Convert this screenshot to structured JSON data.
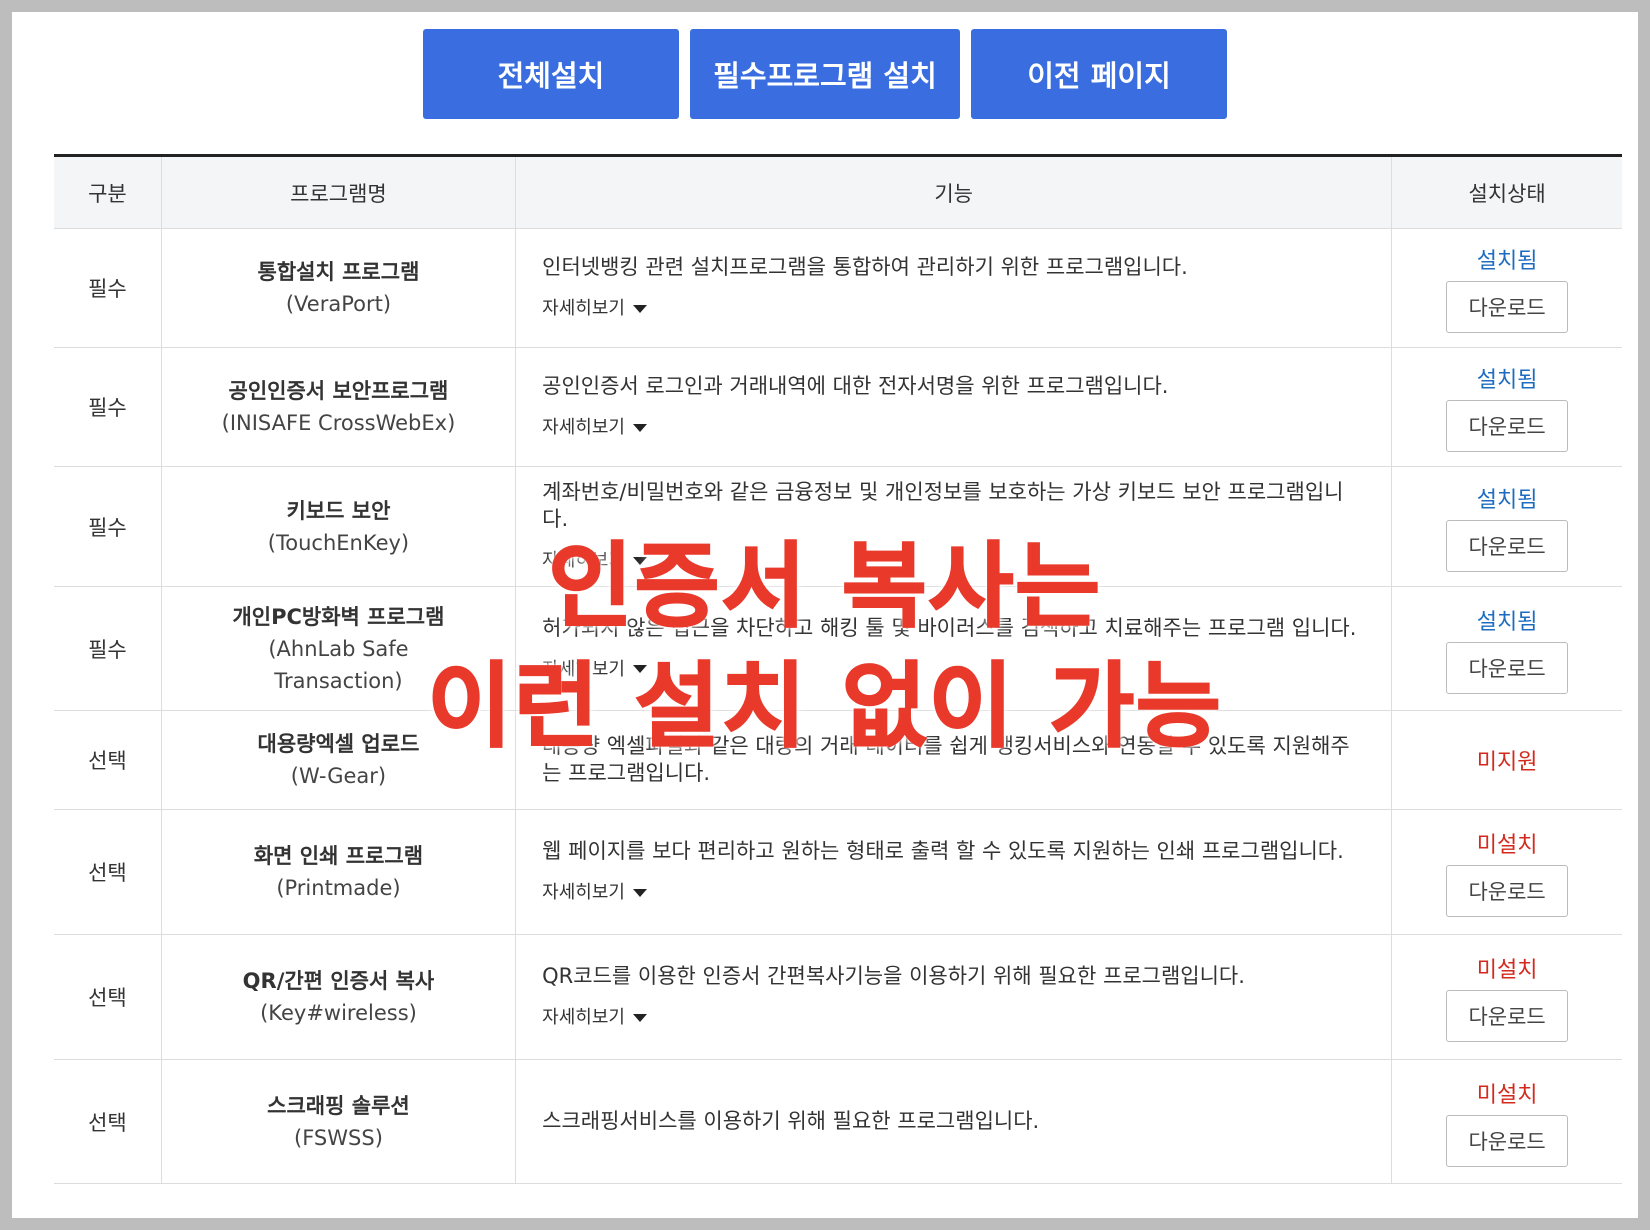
{
  "buttons": {
    "install_all": "전체설치",
    "install_required": "필수프로그램 설치",
    "previous_page": "이전 페이지"
  },
  "table": {
    "headers": {
      "category": "구분",
      "program": "프로그램명",
      "function": "기능",
      "status": "설치상태"
    },
    "rows": [
      {
        "category": "필수",
        "name": "통합설치 프로그램",
        "sub": "(VeraPort)",
        "desc": "인터넷뱅킹 관련 설치프로그램을 통합하여 관리하기 위한 프로그램입니다.",
        "more": "자세히보기",
        "status": "설치됨",
        "download": "다운로드"
      },
      {
        "category": "필수",
        "name": "공인인증서 보안프로그램",
        "sub": "(INISAFE CrossWebEx)",
        "desc": "공인인증서 로그인과 거래내역에 대한 전자서명을 위한 프로그램입니다.",
        "more": "자세히보기",
        "status": "설치됨",
        "download": "다운로드"
      },
      {
        "category": "필수",
        "name": "키보드 보안",
        "sub": "(TouchEnKey)",
        "desc": "계좌번호/비밀번호와 같은 금융정보 및 개인정보를 보호하는 가상 키보드 보안 프로그램입니다.",
        "more": "자세히보기",
        "status": "설치됨",
        "download": "다운로드"
      },
      {
        "category": "필수",
        "name": "개인PC방화벽 프로그램",
        "sub": "(AhnLab Safe Transaction)",
        "desc": "허가되지 않은 접근을 차단하고 해킹 툴 및 바이러스를 검색하고 치료해주는 프로그램 입니다.",
        "more": "자세히보기",
        "status": "설치됨",
        "download": "다운로드"
      },
      {
        "category": "선택",
        "name": "대용량엑셀 업로드",
        "sub": "(W-Gear)",
        "desc": "대용량 엑셀파일과 같은 대량의 거래 데이터를 쉽게 뱅킹서비스와 연동할 수 있도록 지원해주는 프로그램입니다.",
        "more": "",
        "status": "미지원",
        "download": ""
      },
      {
        "category": "선택",
        "name": "화면 인쇄 프로그램",
        "sub": "(Printmade)",
        "desc": "웹 페이지를 보다 편리하고 원하는 형태로 출력 할 수 있도록 지원하는 인쇄 프로그램입니다.",
        "more": "자세히보기",
        "status": "미설치",
        "download": "다운로드"
      },
      {
        "category": "선택",
        "name": "QR/간편 인증서 복사",
        "sub": "(Key#wireless)",
        "desc": "QR코드를 이용한 인증서 간편복사기능을 이용하기 위해 필요한 프로그램입니다.",
        "more": "자세히보기",
        "status": "미설치",
        "download": "다운로드"
      },
      {
        "category": "선택",
        "name": "스크래핑 솔루션",
        "sub": "(FSWSS)",
        "desc": "스크래핑서비스를 이용하기 위해 필요한 프로그램입니다.",
        "more": "",
        "status": "미설치",
        "download": "다운로드"
      }
    ]
  },
  "overlay": {
    "line1": "인증서 복사는",
    "line2": "이런 설치 없이 가능"
  },
  "colors": {
    "button_bg": "#3a6ee0",
    "installed": "#1e6cc0",
    "not_installed": "#d42a1e",
    "overlay": "#e8392a"
  }
}
